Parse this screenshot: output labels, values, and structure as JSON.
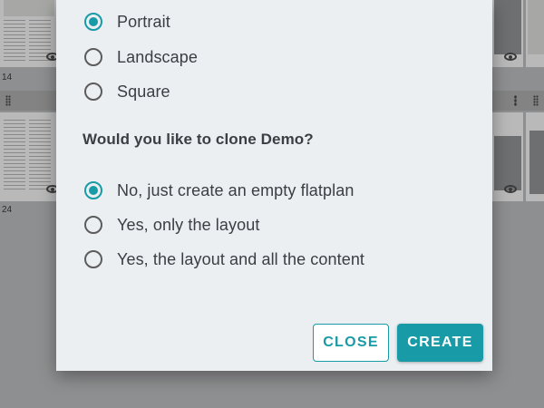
{
  "background": {
    "page_numbers": [
      "14",
      "24"
    ]
  },
  "dialog": {
    "orientation_options": [
      {
        "label": "Portrait",
        "checked": true
      },
      {
        "label": "Landscape",
        "checked": false
      },
      {
        "label": "Square",
        "checked": false
      }
    ],
    "clone_question": "Would you like to clone Demo?",
    "clone_options": [
      {
        "label": "No, just create an empty flatplan",
        "checked": true
      },
      {
        "label": "Yes, only the layout",
        "checked": false
      },
      {
        "label": "Yes, the layout and all the content",
        "checked": false
      }
    ],
    "close_label": "CLOSE",
    "create_label": "CREATE"
  },
  "colors": {
    "accent": "#189ba6",
    "dialog_background": "#ebeff2",
    "overlay": "#8e8f90"
  }
}
